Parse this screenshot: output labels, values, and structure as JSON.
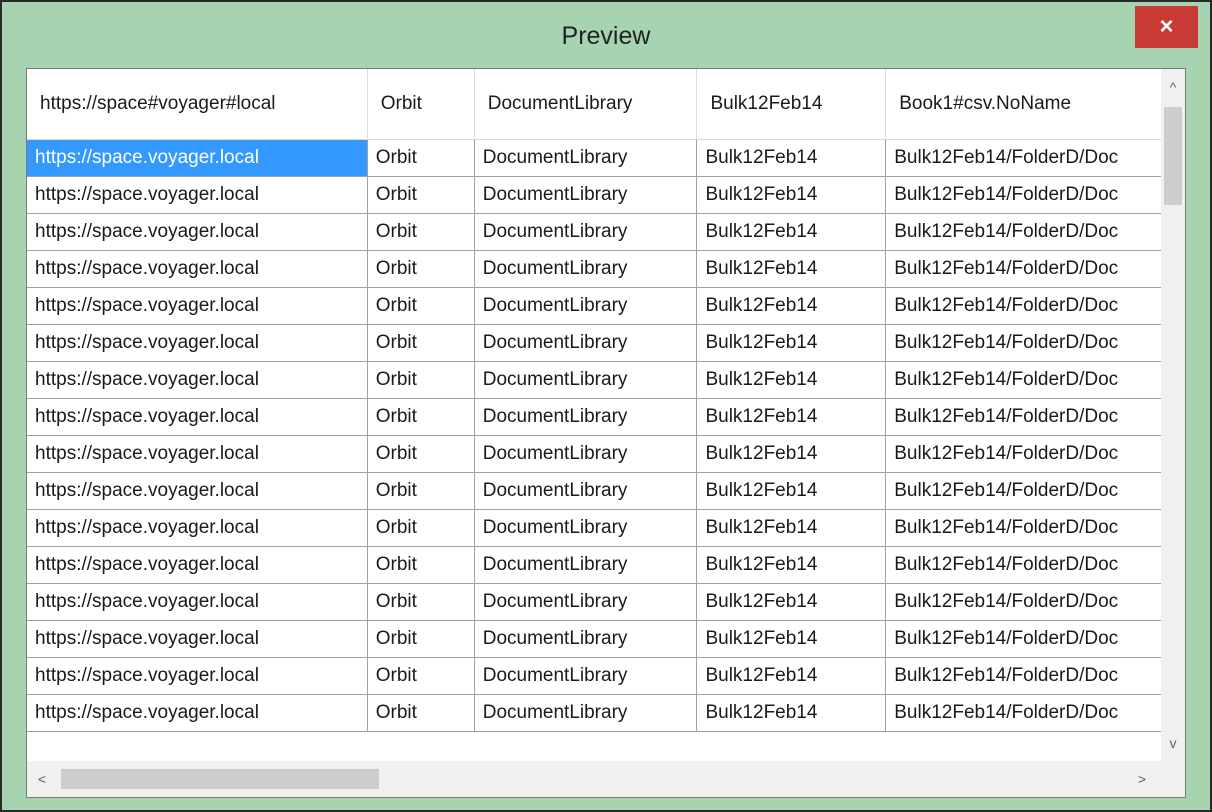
{
  "window": {
    "title": "Preview",
    "close_label": "×"
  },
  "grid": {
    "columns": [
      "https://space#voyager#local",
      "Orbit",
      "DocumentLibrary",
      "Bulk12Feb14",
      "Book1#csv.NoName"
    ],
    "rows": [
      [
        "https://space.voyager.local",
        "Orbit",
        "DocumentLibrary",
        "Bulk12Feb14",
        "Bulk12Feb14/FolderD/Doc"
      ],
      [
        "https://space.voyager.local",
        "Orbit",
        "DocumentLibrary",
        "Bulk12Feb14",
        "Bulk12Feb14/FolderD/Doc"
      ],
      [
        "https://space.voyager.local",
        "Orbit",
        "DocumentLibrary",
        "Bulk12Feb14",
        "Bulk12Feb14/FolderD/Doc"
      ],
      [
        "https://space.voyager.local",
        "Orbit",
        "DocumentLibrary",
        "Bulk12Feb14",
        "Bulk12Feb14/FolderD/Doc"
      ],
      [
        "https://space.voyager.local",
        "Orbit",
        "DocumentLibrary",
        "Bulk12Feb14",
        "Bulk12Feb14/FolderD/Doc"
      ],
      [
        "https://space.voyager.local",
        "Orbit",
        "DocumentLibrary",
        "Bulk12Feb14",
        "Bulk12Feb14/FolderD/Doc"
      ],
      [
        "https://space.voyager.local",
        "Orbit",
        "DocumentLibrary",
        "Bulk12Feb14",
        "Bulk12Feb14/FolderD/Doc"
      ],
      [
        "https://space.voyager.local",
        "Orbit",
        "DocumentLibrary",
        "Bulk12Feb14",
        "Bulk12Feb14/FolderD/Doc"
      ],
      [
        "https://space.voyager.local",
        "Orbit",
        "DocumentLibrary",
        "Bulk12Feb14",
        "Bulk12Feb14/FolderD/Doc"
      ],
      [
        "https://space.voyager.local",
        "Orbit",
        "DocumentLibrary",
        "Bulk12Feb14",
        "Bulk12Feb14/FolderD/Doc"
      ],
      [
        "https://space.voyager.local",
        "Orbit",
        "DocumentLibrary",
        "Bulk12Feb14",
        "Bulk12Feb14/FolderD/Doc"
      ],
      [
        "https://space.voyager.local",
        "Orbit",
        "DocumentLibrary",
        "Bulk12Feb14",
        "Bulk12Feb14/FolderD/Doc"
      ],
      [
        "https://space.voyager.local",
        "Orbit",
        "DocumentLibrary",
        "Bulk12Feb14",
        "Bulk12Feb14/FolderD/Doc"
      ],
      [
        "https://space.voyager.local",
        "Orbit",
        "DocumentLibrary",
        "Bulk12Feb14",
        "Bulk12Feb14/FolderD/Doc"
      ],
      [
        "https://space.voyager.local",
        "Orbit",
        "DocumentLibrary",
        "Bulk12Feb14",
        "Bulk12Feb14/FolderD/Doc"
      ],
      [
        "https://space.voyager.local",
        "Orbit",
        "DocumentLibrary",
        "Bulk12Feb14",
        "Bulk12Feb14/FolderD/Doc"
      ]
    ],
    "selected_row": 0
  },
  "scrollbars": {
    "up_icon": "^",
    "down_icon": "v",
    "left_icon": "<",
    "right_icon": ">"
  },
  "colors": {
    "window_bg": "#a6d3b0",
    "close_bg": "#c83a34",
    "selection": "#3399ff"
  }
}
